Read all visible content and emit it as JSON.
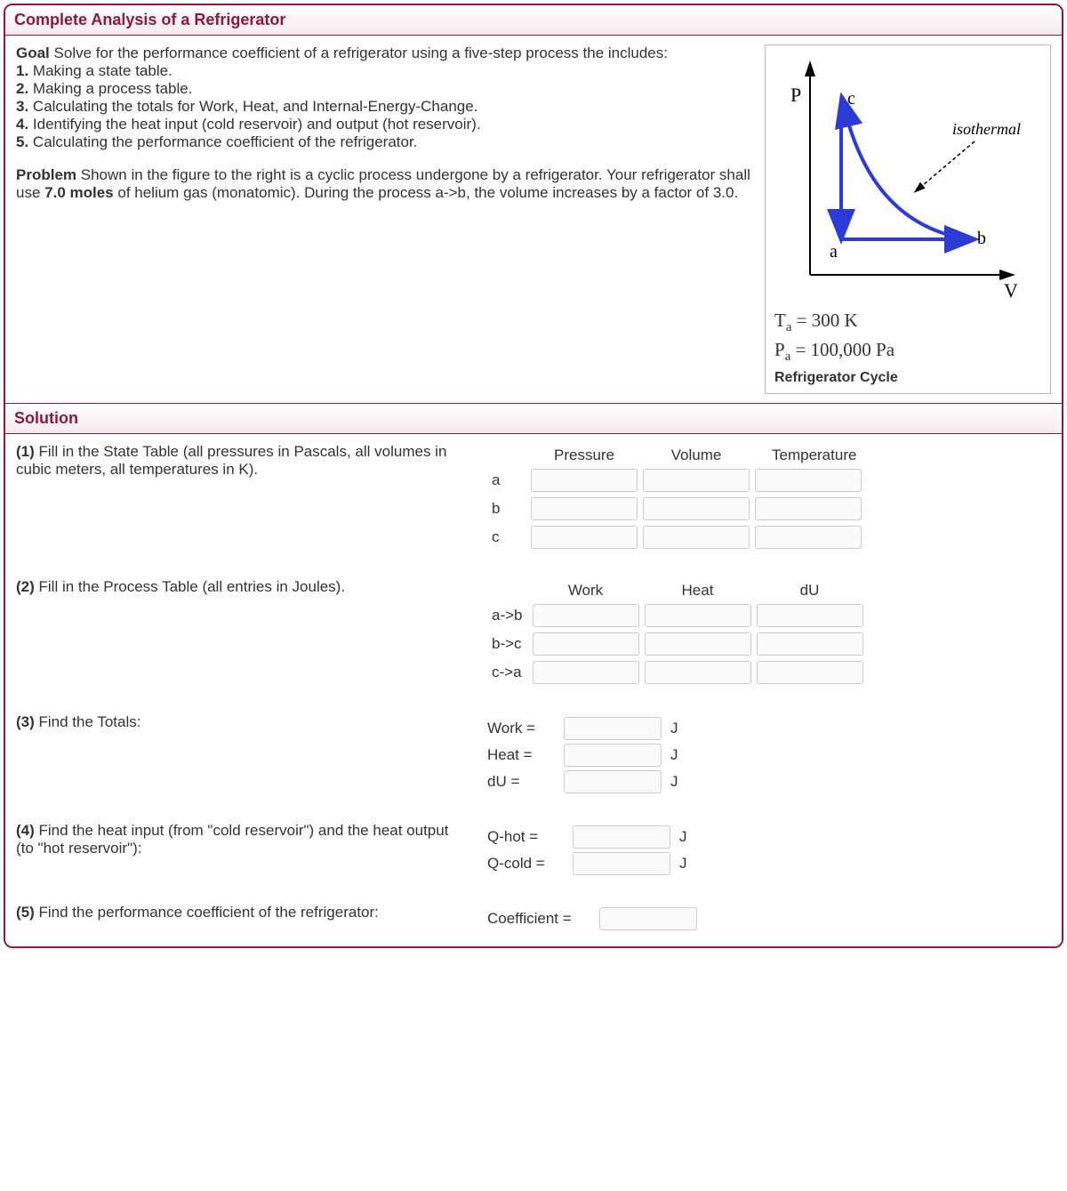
{
  "title": "Complete Analysis of a Refrigerator",
  "goal": {
    "heading": "Goal",
    "intro": "Solve for the performance coefficient of a refrigerator using a five-step process the includes:",
    "steps": [
      "Making a state table.",
      "Making a process table.",
      "Calculating the totals for Work, Heat, and Internal-Energy-Change.",
      "Identifying the heat input (cold reservoir) and output (hot reservoir).",
      "Calculating the performance coefficient of the refrigerator."
    ]
  },
  "problem": {
    "heading": "Problem",
    "text_before_moles": "Shown in the figure to the right is a cyclic process undergone by a refrigerator. Your refrigerator shall use ",
    "moles": "7.0 moles",
    "text_after_moles": " of helium gas (monatomic). During the process a->b, the volume increases by a factor of 3.0."
  },
  "figure": {
    "axis_P": "P",
    "axis_V": "V",
    "label_a": "a",
    "label_b": "b",
    "label_c": "c",
    "isothermal": "isothermal",
    "Ta_line": "T_a = 300 K",
    "Pa_line": "P_a = 100,000 Pa",
    "caption": "Refrigerator Cycle"
  },
  "solution_heading": "Solution",
  "step1": {
    "label": "(1)",
    "text": " Fill in the State Table (all pressures in Pascals, all volumes in cubic meters, all temperatures in K).",
    "cols": [
      "Pressure",
      "Volume",
      "Temperature"
    ],
    "rows": [
      "a",
      "b",
      "c"
    ]
  },
  "step2": {
    "label": "(2)",
    "text": " Fill in the Process Table (all entries in Joules).",
    "cols": [
      "Work",
      "Heat",
      "dU"
    ],
    "rows": [
      "a->b",
      "b->c",
      "c->a"
    ]
  },
  "step3": {
    "label": "(3)",
    "text": " Find the Totals:",
    "items": [
      {
        "name": "Work =",
        "unit": "J"
      },
      {
        "name": "Heat =",
        "unit": "J"
      },
      {
        "name": "dU =",
        "unit": "J"
      }
    ]
  },
  "step4": {
    "label": "(4)",
    "text": " Find the heat input (from \"cold reservoir\") and the heat output (to \"hot reservoir\"):",
    "items": [
      {
        "name": "Q-hot =",
        "unit": "J"
      },
      {
        "name": "Q-cold =",
        "unit": "J"
      }
    ]
  },
  "step5": {
    "label": "(5)",
    "text": " Find the performance coefficient of the refrigerator:",
    "item": {
      "name": "Coefficient ="
    }
  }
}
